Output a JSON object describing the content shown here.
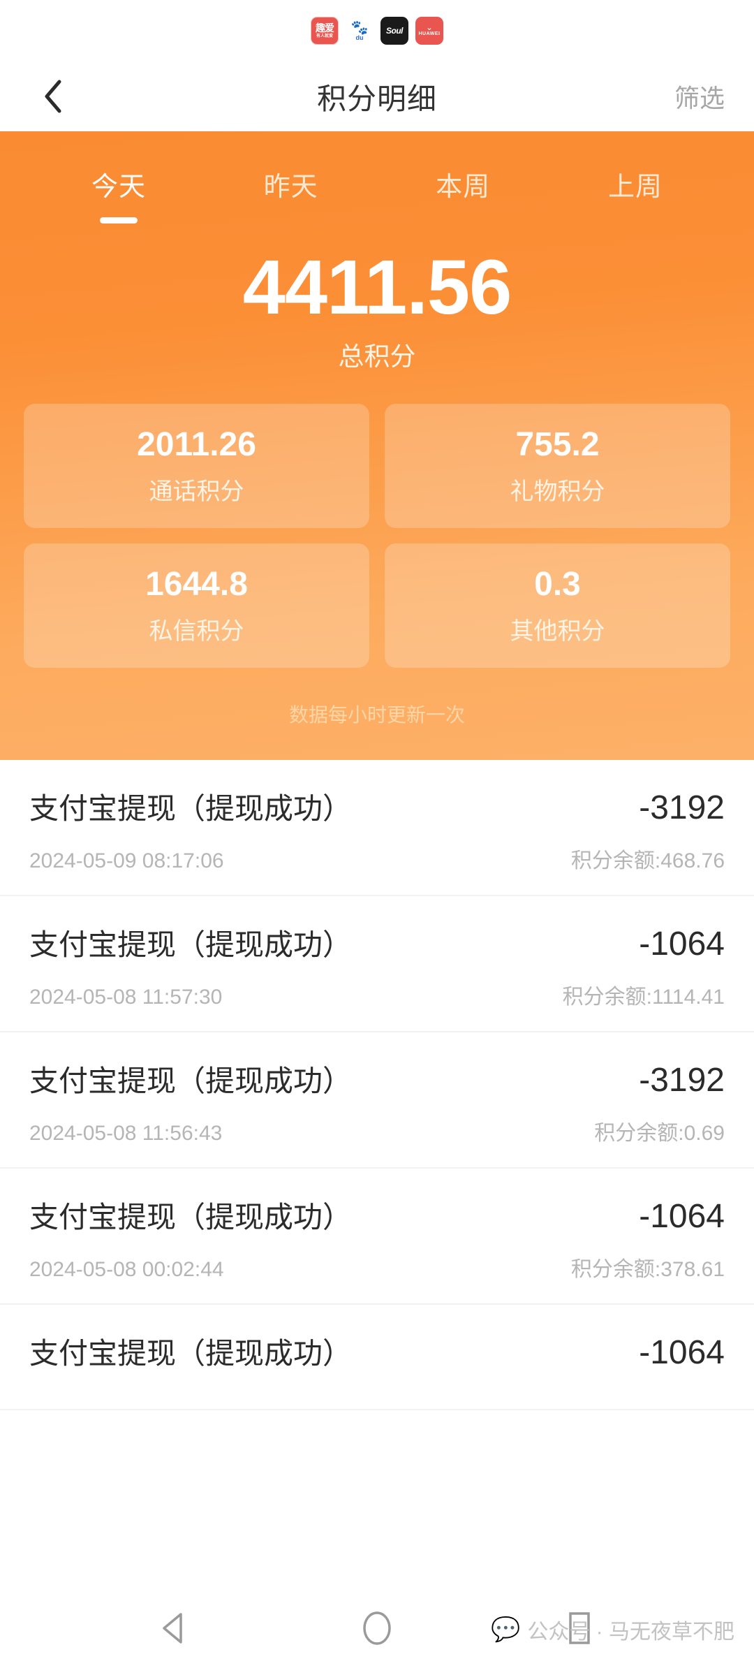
{
  "status_strip": {
    "icons": [
      {
        "name": "quai-app-icon",
        "label": "趣爱",
        "sub": "有人就爱",
        "color": "#e8564f"
      },
      {
        "name": "baidu-app-icon",
        "label": "du",
        "sub": "",
        "color": "#2d6bd8"
      },
      {
        "name": "soul-app-icon",
        "label": "Soul",
        "sub": "",
        "color": "#1a1a1a"
      },
      {
        "name": "huawei-app-icon",
        "label": "HUAWEI",
        "sub": "",
        "color": "#e8564f"
      }
    ]
  },
  "navbar": {
    "back_icon": "chevron-left-icon",
    "title": "积分明细",
    "filter_label": "筛选"
  },
  "hero": {
    "accent_color": "#fa8b33",
    "tabs": [
      {
        "label": "今天",
        "active": true
      },
      {
        "label": "昨天",
        "active": false
      },
      {
        "label": "本周",
        "active": false
      },
      {
        "label": "上周",
        "active": false
      }
    ],
    "total_value": "4411.56",
    "total_label": "总积分",
    "cards": [
      {
        "value": "2011.26",
        "label": "通话积分"
      },
      {
        "value": "755.2",
        "label": "礼物积分"
      },
      {
        "value": "1644.8",
        "label": "私信积分"
      },
      {
        "value": "0.3",
        "label": "其他积分"
      }
    ],
    "note": "数据每小时更新一次"
  },
  "transactions": [
    {
      "title": "支付宝提现（提现成功）",
      "amount": "-3192",
      "time": "2024-05-09 08:17:06",
      "balance": "积分余额:468.76"
    },
    {
      "title": "支付宝提现（提现成功）",
      "amount": "-1064",
      "time": "2024-05-08 11:57:30",
      "balance": "积分余额:1114.41"
    },
    {
      "title": "支付宝提现（提现成功）",
      "amount": "-3192",
      "time": "2024-05-08 11:56:43",
      "balance": "积分余额:0.69"
    },
    {
      "title": "支付宝提现（提现成功）",
      "amount": "-1064",
      "time": "2024-05-08 00:02:44",
      "balance": "积分余额:378.61"
    },
    {
      "title": "支付宝提现（提现成功）",
      "amount": "-1064",
      "time": "",
      "balance": ""
    }
  ],
  "system_nav": {
    "back_icon": "triangle-back-icon",
    "home_icon": "circle-home-icon",
    "recents_icon": "square-recents-icon",
    "watermark_icon": "wechat-icon",
    "watermark_text": "公众号 · 马无夜草不肥"
  }
}
